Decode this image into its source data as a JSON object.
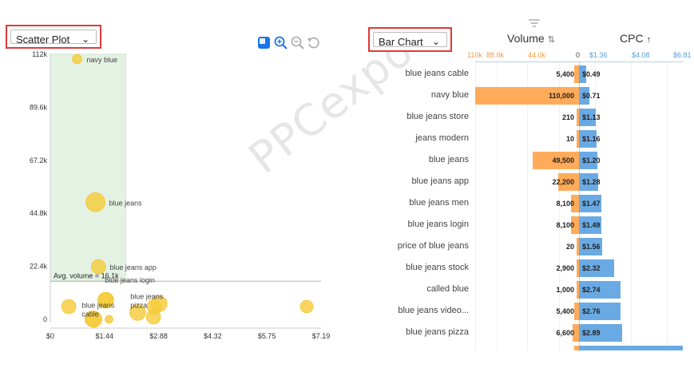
{
  "scatter": {
    "dropdown_label": "Scatter Plot",
    "avg_volume_label": "Avg. volume = 16.1k",
    "toolbar_icons": [
      "select-icon",
      "zoom-in-icon",
      "zoom-out-icon",
      "reset-icon"
    ]
  },
  "barchart": {
    "dropdown_label": "Bar Chart",
    "volume_header": "Volume",
    "cpc_header": "CPC",
    "sort_icon": "⇅",
    "arrow_icon": "↑",
    "volume_scale": [
      "110k",
      "88.0k",
      "44.0k",
      "0"
    ],
    "cpc_scale": [
      "$1.36",
      "$4.08",
      "$6.81"
    ],
    "colors": {
      "volume": "#ffab5a",
      "cpc": "#6aaae4",
      "volume_text": "#f59a3c",
      "cpc_text": "#5a9bd5"
    }
  },
  "watermark": "PPCexpo",
  "chart_data": [
    {
      "type": "scatter",
      "xlabel": "",
      "ylabel": "",
      "xlim": [
        0,
        7.19
      ],
      "ylim": [
        0,
        112000
      ],
      "x_ticks": [
        "$0",
        "$1.44",
        "$2.88",
        "$4.32",
        "$5.75",
        "$7.19"
      ],
      "y_ticks": [
        "0",
        "22.4k",
        "44.8k",
        "67.2k",
        "89.6k",
        "112k"
      ],
      "points": [
        {
          "label": "navy blue",
          "x": 0.71,
          "y": 110000
        },
        {
          "label": "blue jeans",
          "x": 1.2,
          "y": 49500
        },
        {
          "label": "blue jeans app",
          "x": 1.28,
          "y": 22200
        },
        {
          "label": "",
          "x": 0.49,
          "y": 5400
        },
        {
          "label": "blue jeans cable",
          "x": 1.13,
          "y": 210
        },
        {
          "label": "",
          "x": 1.16,
          "y": 10
        },
        {
          "label": "blue jeans login",
          "x": 1.47,
          "y": 8100
        },
        {
          "label": "",
          "x": 1.49,
          "y": 8100
        },
        {
          "label": "",
          "x": 1.56,
          "y": 20
        },
        {
          "label": "",
          "x": 2.32,
          "y": 2900
        },
        {
          "label": "",
          "x": 2.74,
          "y": 1000
        },
        {
          "label": "",
          "x": 2.76,
          "y": 5400
        },
        {
          "label": "blue jeans pizza",
          "x": 2.89,
          "y": 6600
        },
        {
          "label": "",
          "x": 6.81,
          "y": 5400
        }
      ],
      "avg_volume": 16100,
      "avg_cpc": 2.0
    },
    {
      "type": "bar",
      "categories": [
        "blue jeans cable",
        "navy blue",
        "blue jeans store",
        "jeans modern",
        "blue jeans",
        "blue jeans app",
        "blue jeans men",
        "blue jeans login",
        "price of blue jeans",
        "blue jeans stock",
        "called blue",
        "blue jeans video...",
        "blue jeans pizza"
      ],
      "series": [
        {
          "name": "Volume",
          "values": [
            5400,
            110000,
            210,
            10,
            49500,
            22200,
            8100,
            8100,
            20,
            2900,
            1000,
            5400,
            6600
          ],
          "labels": [
            "5,400",
            "110,000",
            "210",
            "10",
            "49,500",
            "22,200",
            "8,100",
            "8,100",
            "20",
            "2,900",
            "1,000",
            "5,400",
            "6,600"
          ]
        },
        {
          "name": "CPC",
          "values": [
            0.49,
            0.71,
            1.13,
            1.16,
            1.2,
            1.28,
            1.47,
            1.49,
            1.56,
            2.32,
            2.74,
            2.76,
            2.89
          ],
          "labels": [
            "$0.49",
            "$0.71",
            "$1.13",
            "$1.16",
            "$1.20",
            "$1.28",
            "$1.47",
            "$1.49",
            "$1.56",
            "$2.32",
            "$2.74",
            "$2.76",
            "$2.89"
          ]
        }
      ],
      "volume_max": 110000,
      "cpc_max": 6.81
    }
  ]
}
